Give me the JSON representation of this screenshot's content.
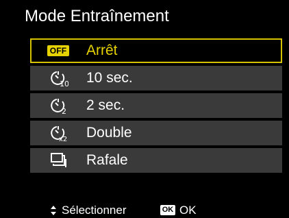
{
  "title": "Mode Entraînement",
  "menu": {
    "items": [
      {
        "badge": "OFF",
        "label": "Arrêt",
        "icon": "off-badge-icon",
        "selected": true
      },
      {
        "label": "10 sec.",
        "icon": "self-timer-10s-icon"
      },
      {
        "label": "2 sec.",
        "icon": "self-timer-2s-icon"
      },
      {
        "label": "Double",
        "icon": "self-timer-double-icon"
      },
      {
        "label": "Rafale",
        "icon": "burst-icon"
      }
    ]
  },
  "hints": {
    "select_label": "Sélectionner",
    "ok_badge": "OK",
    "ok_label": "OK"
  },
  "colors": {
    "accent": "#e6d200",
    "item_bg": "#3a3a3a",
    "background": "#000000"
  }
}
